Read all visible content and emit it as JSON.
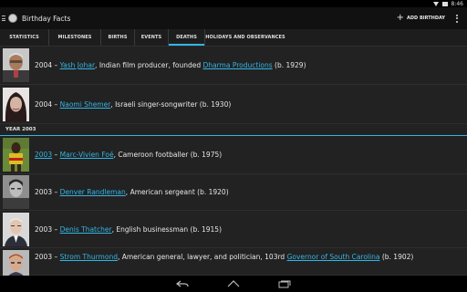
{
  "status": {
    "time": "8:46"
  },
  "app": {
    "title": "Birthday Facts",
    "add_label": "ADD BIRTHDAY"
  },
  "tabs": [
    {
      "label": "STATISTICS"
    },
    {
      "label": "MILESTONES"
    },
    {
      "label": "BIRTHS"
    },
    {
      "label": "EVENTS"
    },
    {
      "label": "DEATHS"
    },
    {
      "label": "HOLIDAYS AND OBSERVANCES"
    }
  ],
  "active_tab": "DEATHS",
  "accent_color": "#33b5e5",
  "section_header": "YEAR 2003",
  "rows_top": [
    {
      "pre": "2004 – ",
      "link1": "Yash Johar",
      "mid": ", Indian film producer, founded ",
      "link2": "Dharma Productions",
      "post": " (b. 1929)"
    },
    {
      "pre": "2004 – ",
      "link1": "Naomi Shemer",
      "mid": ", Israeli singer-songwriter (b. 1930)",
      "link2": "",
      "post": ""
    }
  ],
  "rows_bottom": [
    {
      "pre_link": "2003",
      "pre": " – ",
      "link1": "Marc-Vivien Foé",
      "mid": ", Cameroon footballer (b. 1975)",
      "link2": "",
      "post": ""
    },
    {
      "pre_link": "",
      "pre": "2003 – ",
      "link1": "Denver Randleman",
      "mid": ", American sergeant (b. 1920)",
      "link2": "",
      "post": ""
    },
    {
      "pre_link": "",
      "pre": "2003 – ",
      "link1": "Denis Thatcher",
      "mid": ", English businessman (b. 1915)",
      "link2": "",
      "post": ""
    },
    {
      "pre_link": "",
      "pre": "2003 – ",
      "link1": "Strom Thurmond",
      "mid": ", American general, lawyer, and politician, 103rd ",
      "link2": "Governor of South Carolina",
      "post": " (b. 1902)"
    }
  ],
  "icons": {
    "menu": "hamburger-icon",
    "logo": "app-logo-icon",
    "add": "plus-icon",
    "overflow": "overflow-icon",
    "back": "back-icon",
    "home": "home-icon",
    "recents": "recents-icon"
  }
}
